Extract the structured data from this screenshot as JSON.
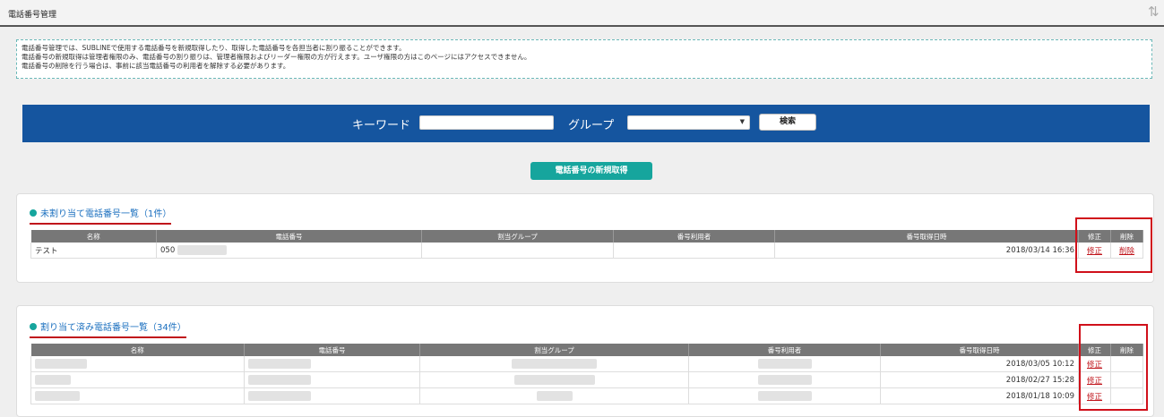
{
  "header": {
    "title": "電話番号管理",
    "reload_icon": "reload-icon"
  },
  "info": {
    "lines": [
      "電話番号管理では、SUBLINEで使用する電話番号を新規取得したり、取得した電話番号を各担当者に割り振ることができます。",
      "電話番号の新規取得は管理者権限のみ、電話番号の割り振りは、管理者権限およびリーダー権限の方が行えます。ユーザ権限の方はこのページにはアクセスできません。",
      "電話番号の削除を行う場合は、事前に該当電話番号の利用者を解除する必要があります。"
    ]
  },
  "search": {
    "keyword_label": "キーワード",
    "keyword_value": "",
    "group_label": "グループ",
    "group_value": "",
    "button": "検索"
  },
  "new_button": "電話番号の新規取得",
  "unassigned": {
    "title": "未割り当て電話番号一覧（1件）",
    "columns": [
      "名称",
      "電話番号",
      "割当グループ",
      "番号利用者",
      "番号取得日時",
      "修正",
      "削除"
    ],
    "rows": [
      {
        "name": "テスト",
        "phone": "050",
        "group": "",
        "user": "",
        "date": "2018/03/14 16:36",
        "edit": "修正",
        "delete": "削除"
      }
    ]
  },
  "assigned": {
    "title": "割り当て済み電話番号一覧（34件）",
    "columns": [
      "名称",
      "電話番号",
      "割当グループ",
      "番号利用者",
      "番号取得日時",
      "修正",
      "削除"
    ],
    "rows": [
      {
        "date": "2018/03/05 10:12",
        "edit": "修正"
      },
      {
        "date": "2018/02/27 15:28",
        "edit": "修正"
      },
      {
        "date": "2018/01/18 10:09",
        "edit": "修正"
      }
    ]
  },
  "colors": {
    "accent": "#15559f",
    "teal": "#16a59d",
    "highlight_red": "#d0101a"
  }
}
